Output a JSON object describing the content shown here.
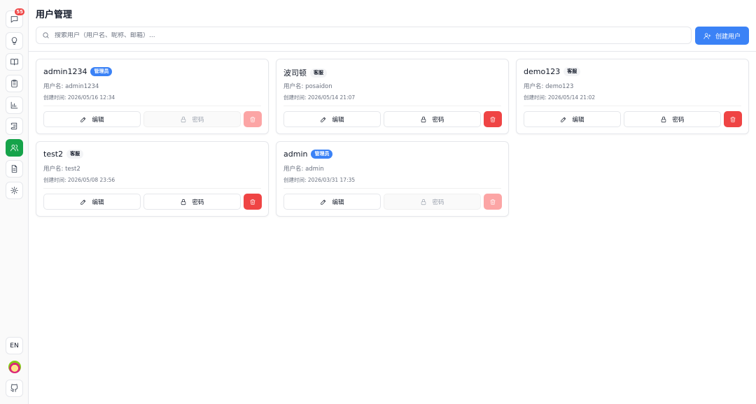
{
  "page": {
    "title": "用户管理"
  },
  "search": {
    "placeholder": "搜索用户（用户名、昵称、邮箱）..."
  },
  "toolbar": {
    "create_label": "创建用户"
  },
  "sidebar": {
    "notification_count": "55",
    "items": [
      {
        "icon": "message-icon"
      },
      {
        "icon": "lightbulb-icon"
      },
      {
        "icon": "book-icon"
      },
      {
        "icon": "clipboard-icon"
      },
      {
        "icon": "bar-chart-icon"
      },
      {
        "icon": "scroll-icon"
      },
      {
        "icon": "users-icon",
        "active": true
      },
      {
        "icon": "document-icon"
      },
      {
        "icon": "settings-icon"
      }
    ],
    "language_label": "EN"
  },
  "users": [
    {
      "name": "admin1234",
      "role": "管理员",
      "username": "用户名: admin1234",
      "created": "创建时间: 2026/05/16 12:34",
      "edit": "编辑",
      "password": "密码",
      "password_enabled": false,
      "delete_enabled": false
    },
    {
      "name": "波司顿",
      "role": "客服",
      "username": "用户名: posaidon",
      "created": "创建时间: 2026/05/14 21:07",
      "edit": "编辑",
      "password": "密码",
      "password_enabled": true,
      "delete_enabled": true
    },
    {
      "name": "demo123",
      "role": "客服",
      "username": "用户名: demo123",
      "created": "创建时间: 2026/05/14 21:02",
      "edit": "编辑",
      "password": "密码",
      "password_enabled": true,
      "delete_enabled": true
    },
    {
      "name": "test2",
      "role": "客服",
      "username": "用户名: test2",
      "created": "创建时间: 2026/05/08 23:56",
      "edit": "编辑",
      "password": "密码",
      "password_enabled": true,
      "delete_enabled": true
    },
    {
      "name": "admin",
      "role": "管理员",
      "username": "用户名: admin",
      "created": "创建时间: 2026/03/31 17:35",
      "edit": "编辑",
      "password": "密码",
      "password_enabled": false,
      "delete_enabled": false
    }
  ]
}
